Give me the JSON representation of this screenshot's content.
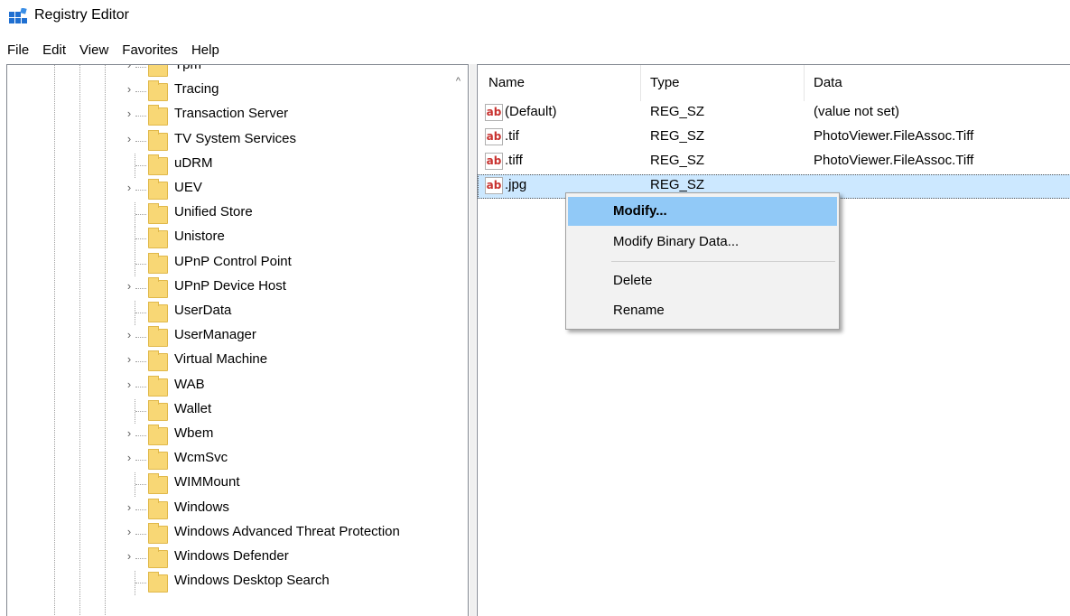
{
  "window": {
    "title": "Registry Editor"
  },
  "menu": [
    "File",
    "Edit",
    "View",
    "Favorites",
    "Help"
  ],
  "tree": {
    "items": [
      {
        "label": "Tpm",
        "expandable": true
      },
      {
        "label": "Tracing",
        "expandable": true
      },
      {
        "label": "Transaction Server",
        "expandable": true
      },
      {
        "label": "TV System Services",
        "expandable": true
      },
      {
        "label": "uDRM",
        "expandable": false
      },
      {
        "label": "UEV",
        "expandable": true
      },
      {
        "label": "Unified Store",
        "expandable": false
      },
      {
        "label": "Unistore",
        "expandable": false
      },
      {
        "label": "UPnP Control Point",
        "expandable": false
      },
      {
        "label": "UPnP Device Host",
        "expandable": true
      },
      {
        "label": "UserData",
        "expandable": false
      },
      {
        "label": "UserManager",
        "expandable": true
      },
      {
        "label": "Virtual Machine",
        "expandable": true
      },
      {
        "label": "WAB",
        "expandable": true
      },
      {
        "label": "Wallet",
        "expandable": false
      },
      {
        "label": "Wbem",
        "expandable": true
      },
      {
        "label": "WcmSvc",
        "expandable": true
      },
      {
        "label": "WIMMount",
        "expandable": false
      },
      {
        "label": "Windows",
        "expandable": true
      },
      {
        "label": "Windows Advanced Threat Protection",
        "expandable": true
      },
      {
        "label": "Windows Defender",
        "expandable": true
      },
      {
        "label": "Windows Desktop Search",
        "expandable": false
      }
    ],
    "expander_glyph": "›",
    "scroll_up_glyph": "^"
  },
  "list": {
    "columns": {
      "name": "Name",
      "type": "Type",
      "data": "Data"
    },
    "rows": [
      {
        "name": "(Default)",
        "type": "REG_SZ",
        "data": "(value not set)",
        "icon": "ab",
        "selected": false
      },
      {
        "name": ".tif",
        "type": "REG_SZ",
        "data": "PhotoViewer.FileAssoc.Tiff",
        "icon": "ab",
        "selected": false
      },
      {
        "name": ".tiff",
        "type": "REG_SZ",
        "data": "PhotoViewer.FileAssoc.Tiff",
        "icon": "ab",
        "selected": false
      },
      {
        "name": ".jpg",
        "type": "REG_SZ",
        "data": "",
        "icon": "ab",
        "selected": true
      }
    ]
  },
  "context_menu": {
    "items": [
      {
        "label": "Modify...",
        "default": true,
        "highlighted": true
      },
      {
        "label": "Modify Binary Data...",
        "default": false,
        "highlighted": false
      },
      {
        "label": "Delete",
        "default": false,
        "highlighted": false
      },
      {
        "label": "Rename",
        "default": false,
        "highlighted": false
      }
    ]
  },
  "colors": {
    "folder": "#f8d775",
    "selection": "#cce8ff",
    "menu_highlight": "#91c9f7",
    "string_icon_text": "#c8322f"
  }
}
